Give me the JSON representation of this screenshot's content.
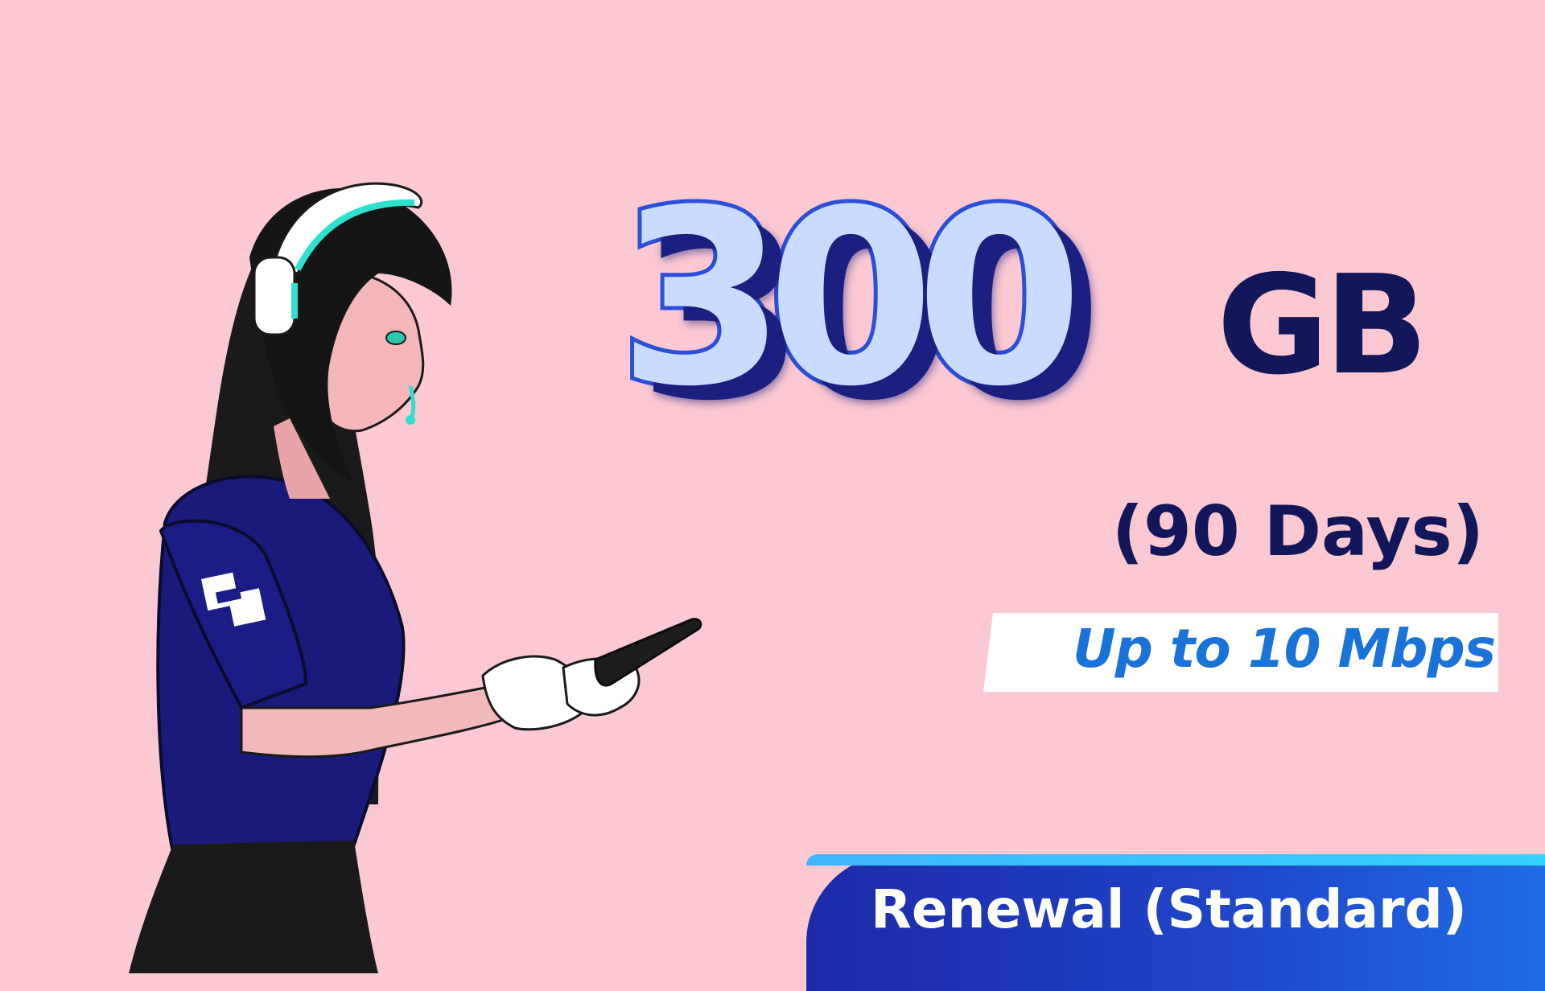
{
  "offer": {
    "amount": "300",
    "unit": "GB",
    "duration": "(90 Days)",
    "speed": "Up to 10 Mbps",
    "plan": "Renewal (Standard)"
  },
  "colors": {
    "background": "#fcc8d2",
    "navy": "#14165a",
    "accent_blue": "#1a73d9",
    "badge_blue": "#1f44c8",
    "headset_teal": "#2fe0d0"
  },
  "icons": [
    "headset-icon",
    "brand-logo-icon",
    "smartphone-icon"
  ]
}
